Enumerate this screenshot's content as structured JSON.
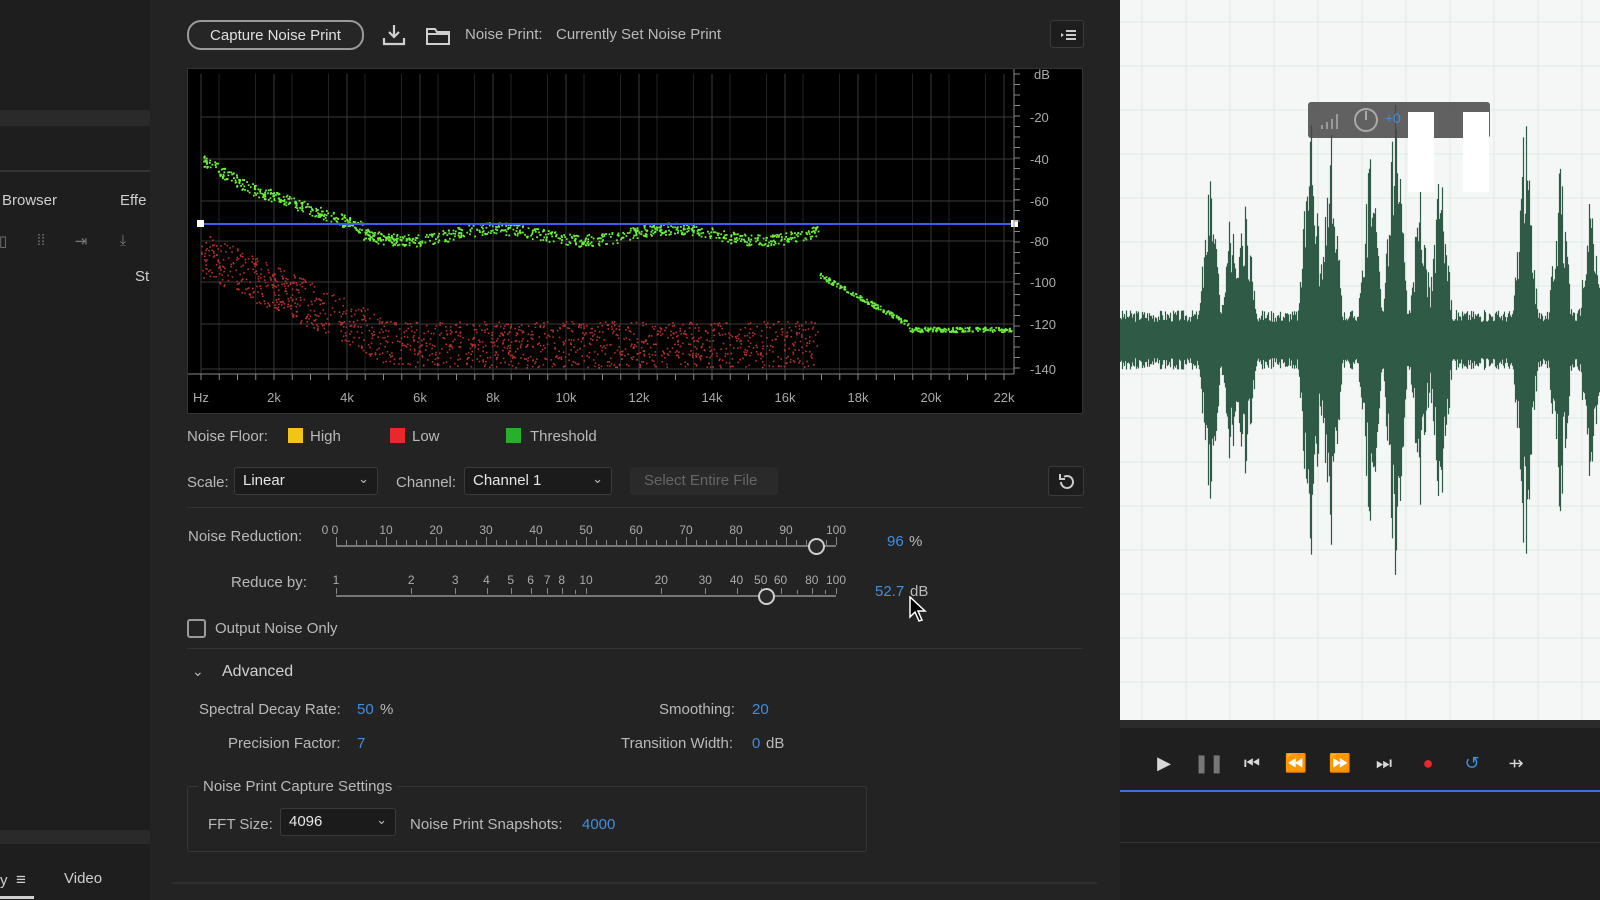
{
  "left_panel": {
    "tab_browser": "Browser",
    "tab_effects": "Effe",
    "truncated_label": "St",
    "bottom_tab_video": "Video",
    "bottom_tab_partial": "y"
  },
  "toolbar": {
    "capture_button": "Capture Noise Print",
    "noise_print_label": "Noise Print:",
    "noise_print_value": "Currently Set Noise Print",
    "icons": [
      "download-icon",
      "folder-icon",
      "panel-menu-icon"
    ]
  },
  "graph": {
    "db_label": "dB",
    "y_ticks": [
      "-20",
      "-40",
      "-60",
      "-80",
      "-100",
      "-120",
      "-140"
    ],
    "x_ticks": [
      "Hz",
      "2k",
      "4k",
      "6k",
      "8k",
      "10k",
      "12k",
      "14k",
      "16k",
      "18k",
      "20k",
      "22k"
    ]
  },
  "legend": {
    "title": "Noise Floor:",
    "items": [
      {
        "label": "High",
        "color": "#f2c414"
      },
      {
        "label": "Low",
        "color": "#e8282b"
      },
      {
        "label": "Threshold",
        "color": "#28b02a"
      }
    ]
  },
  "controls": {
    "scale_label": "Scale:",
    "scale_value": "Linear",
    "channel_label": "Channel:",
    "channel_value": "Channel 1",
    "select_entire_file": "Select Entire File"
  },
  "noise_reduction": {
    "label": "Noise Reduction:",
    "value": "96",
    "unit": "%",
    "level": 0.96,
    "scale_start": "0 0",
    "ticks": [
      "10",
      "20",
      "30",
      "40",
      "50",
      "60",
      "70",
      "80",
      "90",
      "100"
    ]
  },
  "reduce_by": {
    "label": "Reduce by:",
    "value": "52.7",
    "unit": "dB",
    "ticks": [
      "1",
      "2",
      "3",
      "4",
      "5",
      "6",
      "7",
      "8",
      "10",
      "20",
      "30",
      "40",
      "50",
      "60",
      "80",
      "100"
    ]
  },
  "output_noise_only": "Output Noise Only",
  "advanced": {
    "title": "Advanced",
    "spectral_decay_label": "Spectral Decay Rate:",
    "spectral_decay_value": "50",
    "spectral_decay_unit": "%",
    "smoothing_label": "Smoothing:",
    "smoothing_value": "20",
    "precision_label": "Precision Factor:",
    "precision_value": "7",
    "transition_label": "Transition Width:",
    "transition_value": "0",
    "transition_unit": "dB"
  },
  "capture_settings": {
    "title": "Noise Print Capture Settings",
    "fft_label": "FFT Size:",
    "fft_value": "4096",
    "snapshots_label": "Noise Print Snapshots:",
    "snapshots_value": "4000"
  },
  "waveform": {
    "hud_value": "+0",
    "colors": {
      "wave": "#2f5a46",
      "background": "#f4f7f5",
      "accent": "#3d8fe0",
      "record": "#e8282b"
    }
  }
}
